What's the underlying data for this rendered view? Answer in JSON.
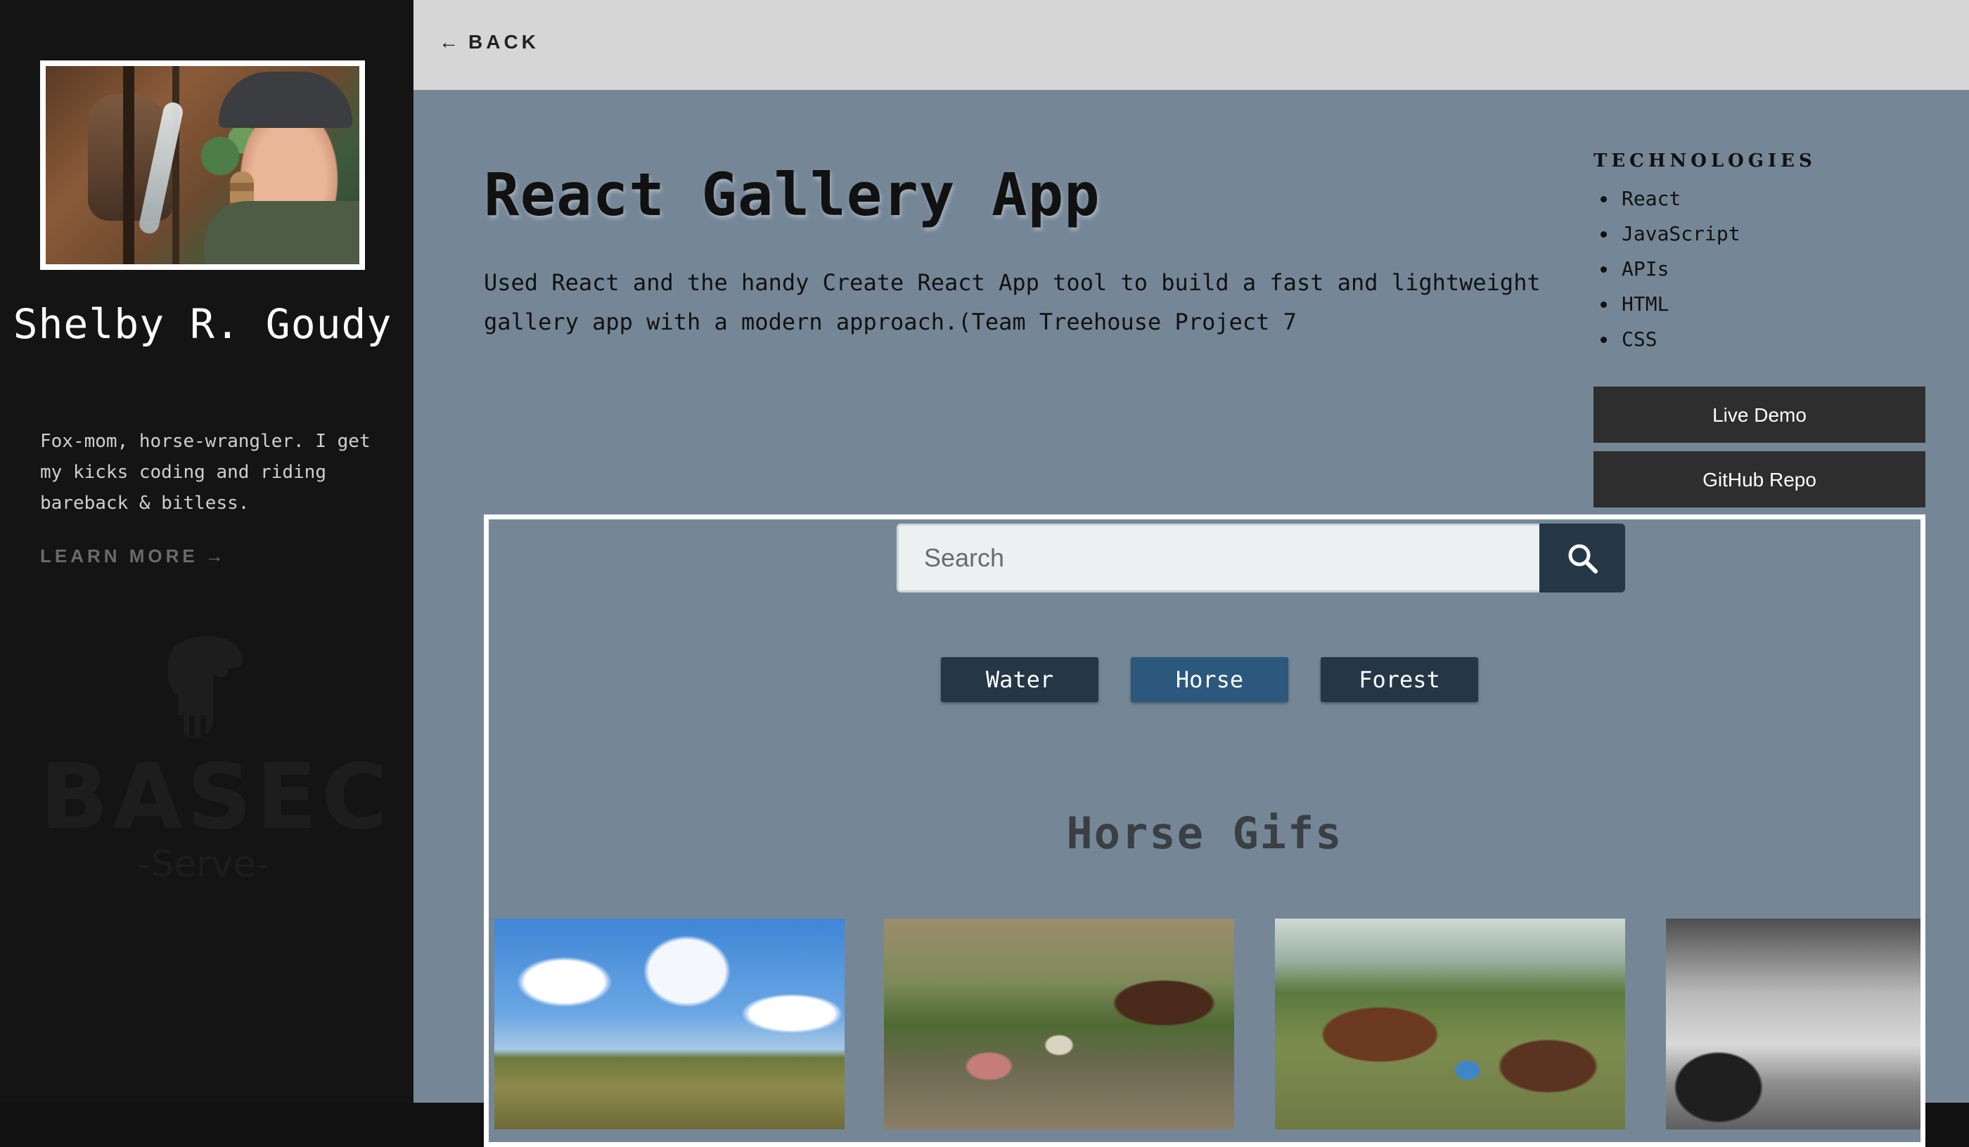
{
  "sidebar": {
    "name": "Shelby R. Goudy",
    "bio": "Fox-mom, horse-wrangler. I get my kicks coding and riding bareback & bitless.",
    "learn_more": "LEARN MORE",
    "learn_more_arrow": "→",
    "watermark_text": "BASEC",
    "watermark_sub": "-Serve-"
  },
  "topbar": {
    "back_arrow": "←",
    "back_label": "BACK"
  },
  "project": {
    "title": "React Gallery App",
    "description": "Used React and the handy Create React App tool to build a fast and lightweight gallery app with a modern approach.(Team Treehouse Project 7",
    "technologies_heading": "TECHNOLOGIES",
    "technologies": [
      "React",
      "JavaScript",
      "APIs",
      "HTML",
      "CSS"
    ],
    "live_demo_label": "Live Demo",
    "github_repo_label": "GitHub Repo"
  },
  "preview": {
    "search_placeholder": "Search",
    "search_icon": "search-icon",
    "filters": [
      {
        "label": "Water",
        "active": false
      },
      {
        "label": "Horse",
        "active": true
      },
      {
        "label": "Forest",
        "active": false
      }
    ],
    "gallery_title": "Horse Gifs"
  },
  "colors": {
    "sidebar_bg": "#141414",
    "topbar_bg": "#d6d6d6",
    "main_bg": "#758797",
    "dark_button": "#2e2e2e",
    "filter_button": "#253747",
    "filter_button_active": "#2b587c"
  }
}
